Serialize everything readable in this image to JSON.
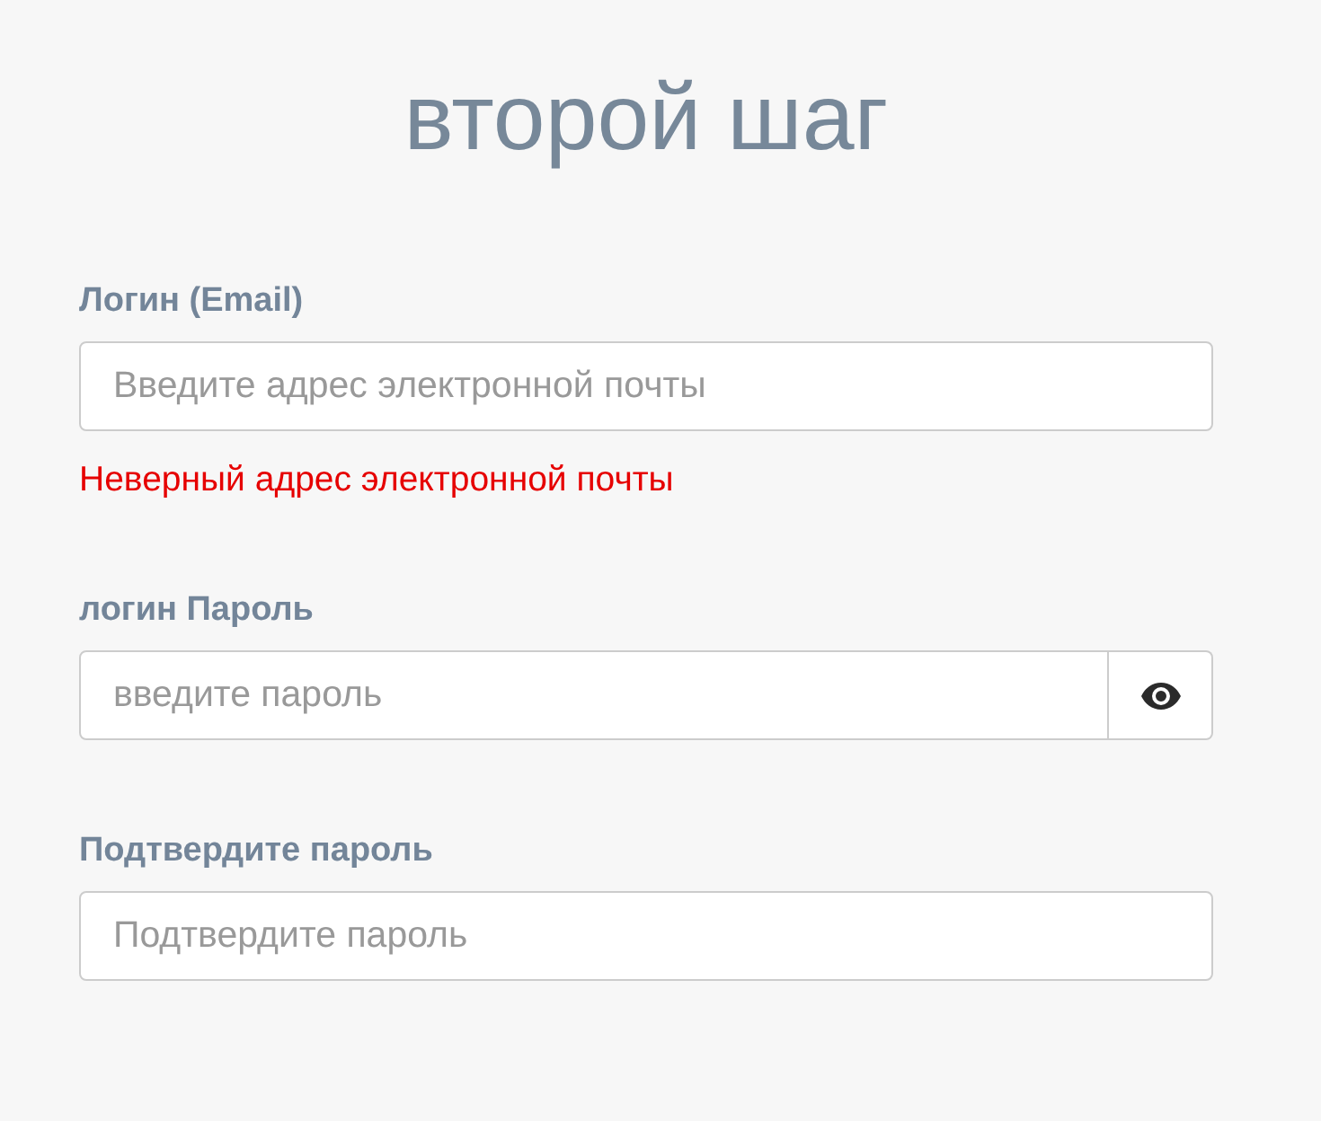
{
  "title": "второй шаг",
  "fields": [
    {
      "label": "Логин (Email)",
      "placeholder": "Введите адрес электронной почты",
      "error": "Неверный адрес электронной почты"
    },
    {
      "label": "логин Пароль",
      "placeholder": "введите пароль",
      "reveal_button": true
    },
    {
      "label": "Подтвердите пароль",
      "placeholder": "Подтвердите пароль"
    }
  ]
}
